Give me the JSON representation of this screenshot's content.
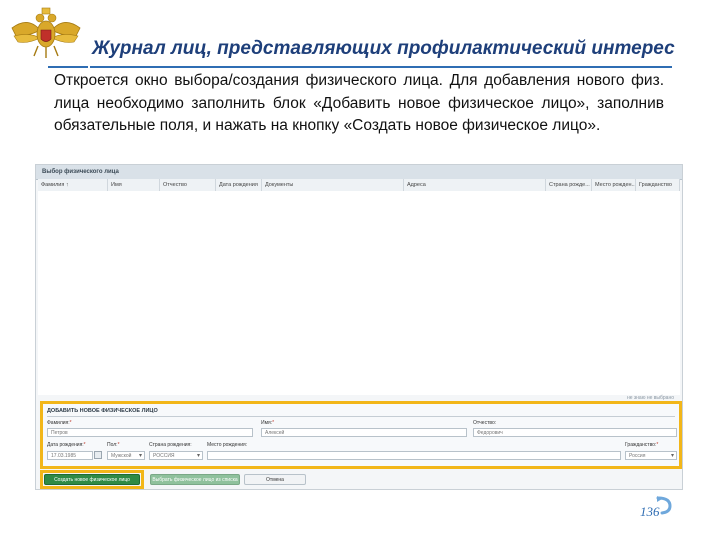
{
  "slide": {
    "title": "Журнал лиц, представляющих профилактический интерес",
    "body": "Откроется окно выбора/создания физического лица. Для добавления нового физ. лица необходимо заполнить блок «Добавить новое физическое лицо», заполнив обязательные поля, и нажать на кнопку «Создать новое физическое лицо».",
    "page_number": "136",
    "accent_color": "#2f6db3",
    "highlight_color": "#f2b619"
  },
  "window": {
    "title": "Выбор физического лица",
    "columns": [
      "Фамилия ↑",
      "Имя",
      "Отчество",
      "Дата рождения",
      "Документы",
      "Адреса",
      "Страна рожде...",
      "Место рожден...",
      "Гражданство"
    ],
    "hint": "не знаю не выбрано"
  },
  "add_section": {
    "title": "ДОБАВИТЬ НОВОЕ ФИЗИЧЕСКОЕ ЛИЦО",
    "fields": {
      "surname": {
        "label": "Фамилия:",
        "value": "Петров"
      },
      "name": {
        "label": "Имя:",
        "value": "Алексей"
      },
      "patronymic": {
        "label": "Отчество:",
        "value": "Федорович"
      },
      "birth_date": {
        "label": "Дата рождения:",
        "value": "17.03.1985"
      },
      "sex": {
        "label": "Пол:",
        "value": "Мужской"
      },
      "birth_country": {
        "label": "Страна рождения:",
        "value": "РОССИЯ"
      },
      "birth_place": {
        "label": "Место рождения:",
        "value": ""
      },
      "citizenship": {
        "label": "Гражданство:",
        "value": "Россия"
      }
    }
  },
  "buttons": {
    "create": "Создать новое физическое лицо",
    "select": "Выбрать физическое лицо из списка",
    "cancel": "Отмена"
  }
}
